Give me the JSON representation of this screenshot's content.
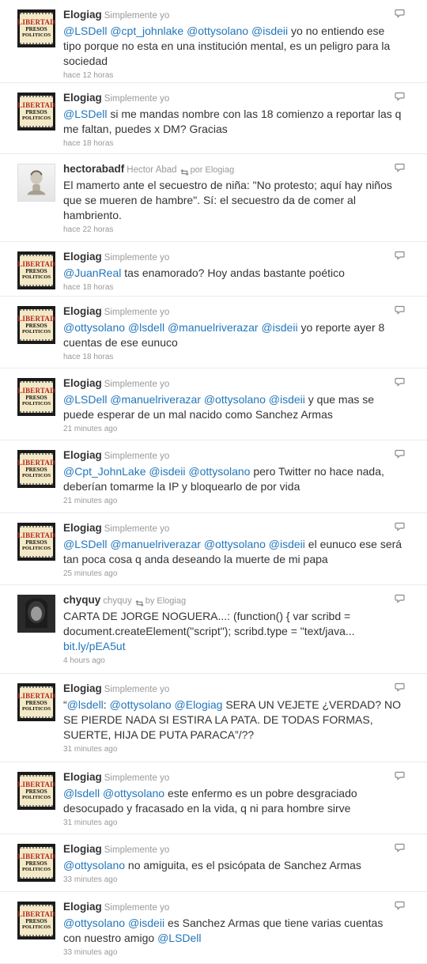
{
  "tweets": [
    {
      "user": "Elogiag",
      "fullname": "Simplemente yo",
      "rt_by": "",
      "avatar": "libertad",
      "segments": [
        {
          "t": "@LSDell",
          "m": true
        },
        {
          "t": " "
        },
        {
          "t": "@cpt_johnlake",
          "m": true
        },
        {
          "t": " "
        },
        {
          "t": "@ottysolano",
          "m": true
        },
        {
          "t": " "
        },
        {
          "t": "@isdeii",
          "m": true
        },
        {
          "t": " yo no entiendo ese tipo porque no esta en una institución mental, es un peligro para la sociedad"
        }
      ],
      "time": "hace 12 horas"
    },
    {
      "user": "Elogiag",
      "fullname": "Simplemente yo",
      "rt_by": "",
      "avatar": "libertad",
      "segments": [
        {
          "t": "@LSDell",
          "m": true
        },
        {
          "t": " si me mandas nombre con las 18 comienzo a reportar las q me faltan, puedes x DM? Gracias"
        }
      ],
      "time": "hace 18 horas"
    },
    {
      "user": "hectorabadf",
      "fullname": "Hector Abad",
      "rt_by": "por Elogiag",
      "avatar": "photo",
      "segments": [
        {
          "t": "El mamerto ante el secuestro de niña: \"No protesto; aquí hay niños que se mueren de hambre\". Sí: el secuestro da de comer al hambriento."
        }
      ],
      "time": "hace 22 horas"
    },
    {
      "user": "Elogiag",
      "fullname": "Simplemente yo",
      "rt_by": "",
      "avatar": "libertad",
      "segments": [
        {
          "t": "@JuanReal",
          "m": true
        },
        {
          "t": " tas enamorado? Hoy andas bastante poético"
        }
      ],
      "time": "hace 18 horas"
    },
    {
      "user": "Elogiag",
      "fullname": "Simplemente yo",
      "rt_by": "",
      "avatar": "libertad",
      "segments": [
        {
          "t": "@ottysolano",
          "m": true
        },
        {
          "t": " "
        },
        {
          "t": "@lsdell",
          "m": true
        },
        {
          "t": " "
        },
        {
          "t": "@manuelriverazar",
          "m": true
        },
        {
          "t": " "
        },
        {
          "t": "@isdeii",
          "m": true
        },
        {
          "t": " yo reporte ayer 8 cuentas de ese eunuco"
        }
      ],
      "time": "hace 18 horas"
    },
    {
      "user": "Elogiag",
      "fullname": "Simplemente yo",
      "rt_by": "",
      "avatar": "libertad",
      "segments": [
        {
          "t": "@LSDell",
          "m": true
        },
        {
          "t": " "
        },
        {
          "t": "@manuelriverazar",
          "m": true
        },
        {
          "t": " "
        },
        {
          "t": "@ottysolano",
          "m": true
        },
        {
          "t": " "
        },
        {
          "t": "@isdeii",
          "m": true
        },
        {
          "t": " y que mas se puede esperar de un mal nacido como Sanchez Armas"
        }
      ],
      "time": "21 minutes ago"
    },
    {
      "user": "Elogiag",
      "fullname": "Simplemente yo",
      "rt_by": "",
      "avatar": "libertad",
      "segments": [
        {
          "t": "@Cpt_JohnLake",
          "m": true
        },
        {
          "t": " "
        },
        {
          "t": "@isdeii",
          "m": true
        },
        {
          "t": " "
        },
        {
          "t": "@ottysolano",
          "m": true
        },
        {
          "t": " pero Twitter no hace nada, deberían tomarme la IP y bloquearlo de por vida"
        }
      ],
      "time": "21 minutes ago"
    },
    {
      "user": "Elogiag",
      "fullname": "Simplemente yo",
      "rt_by": "",
      "avatar": "libertad",
      "segments": [
        {
          "t": "@LSDell",
          "m": true
        },
        {
          "t": " "
        },
        {
          "t": "@manuelriverazar",
          "m": true
        },
        {
          "t": " "
        },
        {
          "t": "@ottysolano",
          "m": true
        },
        {
          "t": " "
        },
        {
          "t": "@isdeii",
          "m": true
        },
        {
          "t": " el eunuco ese será tan poca cosa q anda deseando la muerte de mi papa"
        }
      ],
      "time": "25 minutes ago"
    },
    {
      "user": "chyquy",
      "fullname": "chyquy",
      "rt_by": "by Elogiag",
      "avatar": "dark",
      "segments": [
        {
          "t": "CARTA DE JORGE NOGUERA...: (function() { var scribd = document.createElement(\"script\"); scribd.type = \"text/java... "
        },
        {
          "t": "bit.ly/pEA5ut",
          "m": true
        }
      ],
      "time": "4 hours ago"
    },
    {
      "user": "Elogiag",
      "fullname": "Simplemente yo",
      "rt_by": "",
      "avatar": "libertad",
      "segments": [
        {
          "t": "“"
        },
        {
          "t": "@lsdell",
          "m": true
        },
        {
          "t": ": "
        },
        {
          "t": "@ottysolano",
          "m": true
        },
        {
          "t": " "
        },
        {
          "t": "@Elogiag",
          "m": true
        },
        {
          "t": " SERA UN VEJETE ¿VERDAD? NO SE PIERDE NADA SI ESTIRA LA PATA. DE TODAS FORMAS, SUERTE, HIJA DE PUTA PARACA”/??"
        }
      ],
      "time": "31 minutes ago"
    },
    {
      "user": "Elogiag",
      "fullname": "Simplemente yo",
      "rt_by": "",
      "avatar": "libertad",
      "segments": [
        {
          "t": "@lsdell",
          "m": true
        },
        {
          "t": " "
        },
        {
          "t": "@ottysolano",
          "m": true
        },
        {
          "t": " este enfermo es un pobre desgraciado desocupado y fracasado en la vida, q ni para hombre sirve"
        }
      ],
      "time": "31 minutes ago"
    },
    {
      "user": "Elogiag",
      "fullname": "Simplemente yo",
      "rt_by": "",
      "avatar": "libertad",
      "segments": [
        {
          "t": "@ottysolano",
          "m": true
        },
        {
          "t": " no amiguita, es el psicópata de Sanchez Armas"
        }
      ],
      "time": "33 minutes ago"
    },
    {
      "user": "Elogiag",
      "fullname": "Simplemente yo",
      "rt_by": "",
      "avatar": "libertad",
      "segments": [
        {
          "t": "@ottysolano",
          "m": true
        },
        {
          "t": " "
        },
        {
          "t": "@isdeii",
          "m": true
        },
        {
          "t": " es Sanchez Armas que tiene varias cuentas con nuestro amigo "
        },
        {
          "t": "@LSDell",
          "m": true
        }
      ],
      "time": "33 minutes ago"
    }
  ],
  "avatar_text": {
    "l1": "LIBERTAD",
    "l2": "PRESOS",
    "l3": "POLITICOS"
  },
  "colors": {
    "mention": "#2276bb",
    "meta": "#999999",
    "text": "#333333",
    "separator": "#ebebeb"
  }
}
